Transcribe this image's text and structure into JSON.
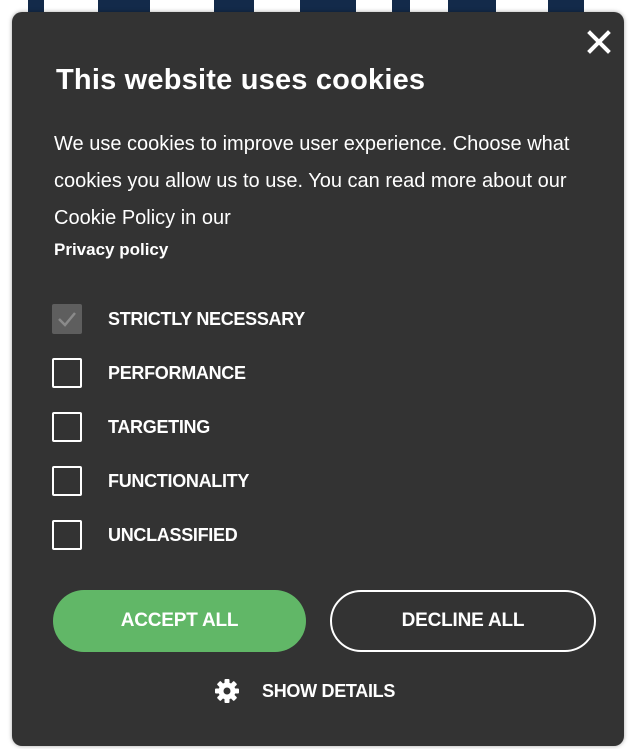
{
  "dialog": {
    "title": "This website uses cookies",
    "description": "We use cookies to improve user experience. Choose what cookies you allow us to use. You can read more about our Cookie Policy in our",
    "privacy_link": "Privacy policy",
    "close_icon": "close-icon"
  },
  "options": [
    {
      "label": "STRICTLY NECESSARY",
      "checked": true,
      "disabled": true
    },
    {
      "label": "PERFORMANCE",
      "checked": false,
      "disabled": false
    },
    {
      "label": "TARGETING",
      "checked": false,
      "disabled": false
    },
    {
      "label": "FUNCTIONALITY",
      "checked": false,
      "disabled": false
    },
    {
      "label": "UNCLASSIFIED",
      "checked": false,
      "disabled": false
    }
  ],
  "buttons": {
    "accept_label": "ACCEPT ALL",
    "decline_label": "DECLINE ALL",
    "show_details_label": "SHOW DETAILS",
    "show_details_icon": "gear-icon"
  },
  "colors": {
    "panel_background": "#333333",
    "accept_green": "#61b767",
    "text": "#ffffff",
    "background_page_bars": "#132a4a"
  }
}
